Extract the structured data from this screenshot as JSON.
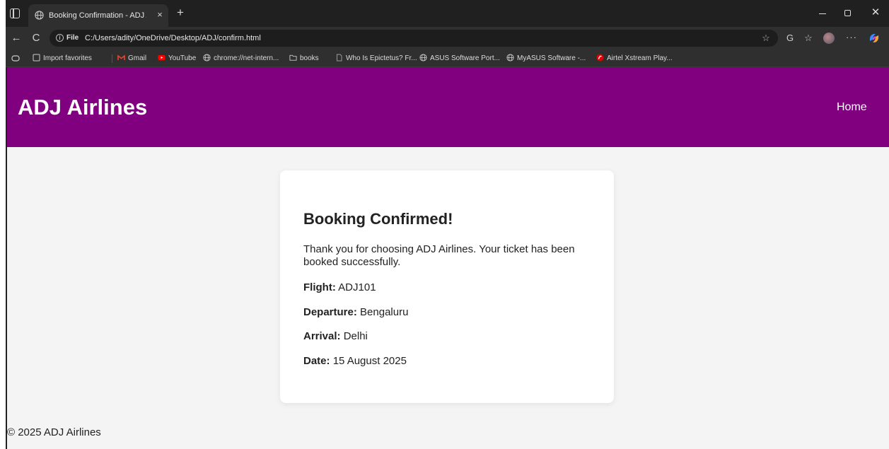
{
  "browser": {
    "tab": {
      "title": "Booking Confirmation - ADJ Airlin",
      "close_glyph": "×"
    },
    "new_tab_glyph": "+",
    "controls": {
      "close_glyph": "✕"
    },
    "toolbar": {
      "back_glyph": "←",
      "reload_glyph": "C",
      "info_glyph": "i",
      "scheme_label": "File",
      "url": "C:/Users/adity/OneDrive/Desktop/ADJ/confirm.html",
      "star_glyph": "☆",
      "refresh_glyph": "G",
      "favorites_glyph": "☆",
      "more_glyph": "···"
    },
    "bookmarks": [
      {
        "label": "Import favorites",
        "icon": "import-icon"
      },
      {
        "label": "Gmail",
        "icon": "gmail-icon"
      },
      {
        "label": "YouTube",
        "icon": "youtube-icon"
      },
      {
        "label": "chrome://net-intern...",
        "icon": "globe-icon"
      },
      {
        "label": "books",
        "icon": "folder-icon"
      },
      {
        "label": "Who Is Epictetus? Fr...",
        "icon": "page-icon"
      },
      {
        "label": "ASUS Software Port...",
        "icon": "globe-icon"
      },
      {
        "label": "MyASUS Software -...",
        "icon": "globe-icon"
      },
      {
        "label": "Airtel Xstream Play...",
        "icon": "airtel-icon"
      }
    ]
  },
  "site": {
    "title": "ADJ Airlines",
    "nav_home": "Home",
    "header_color": "#800080"
  },
  "confirmation": {
    "heading": "Booking Confirmed!",
    "message": "Thank you for choosing ADJ Airlines. Your ticket has been booked successfully.",
    "details": [
      {
        "label": "Flight:",
        "value": "ADJ101"
      },
      {
        "label": "Departure:",
        "value": "Bengaluru"
      },
      {
        "label": "Arrival:",
        "value": "Delhi"
      },
      {
        "label": "Date:",
        "value": "15 August 2025"
      }
    ]
  },
  "footer": {
    "text": "© 2025 ADJ Airlines"
  }
}
